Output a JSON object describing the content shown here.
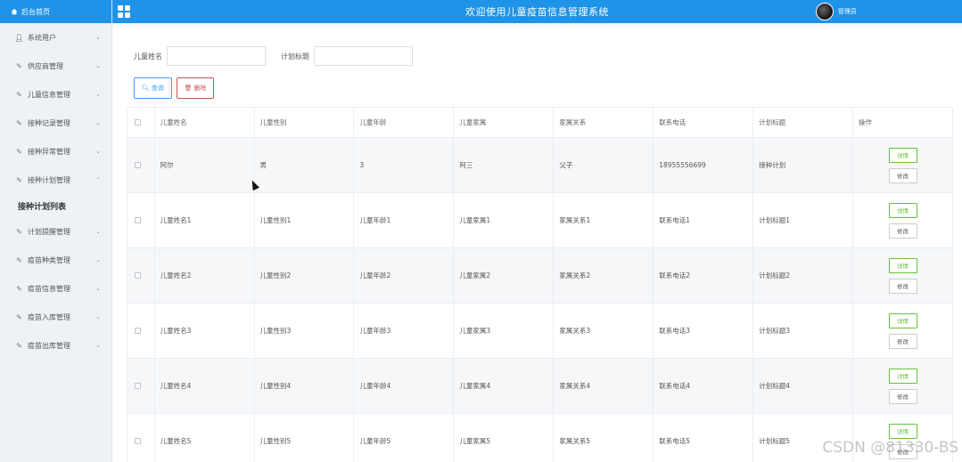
{
  "sidebar": {
    "home_label": "后台首页",
    "items": [
      {
        "label": "系统用户",
        "icon": "user-icon"
      },
      {
        "label": "供应商管理",
        "icon": "edit-icon"
      },
      {
        "label": "儿童信息管理",
        "icon": "edit-icon"
      },
      {
        "label": "接种记录管理",
        "icon": "edit-icon"
      },
      {
        "label": "接种异常管理",
        "icon": "edit-icon"
      },
      {
        "label": "接种计划管理",
        "icon": "edit-icon",
        "expanded": true
      },
      {
        "label": "计划提醒管理",
        "icon": "edit-icon"
      },
      {
        "label": "疫苗种类管理",
        "icon": "edit-icon"
      },
      {
        "label": "疫苗信息管理",
        "icon": "edit-icon"
      },
      {
        "label": "疫苗入库管理",
        "icon": "edit-icon"
      },
      {
        "label": "疫苗出库管理",
        "icon": "edit-icon"
      }
    ],
    "submenu_active": "接种计划列表"
  },
  "header": {
    "title": "欢迎使用儿童疫苗信息管理系统",
    "user_name": "管理员"
  },
  "search": {
    "child_name_label": "儿童姓名",
    "child_name_value": "",
    "plan_title_label": "计划标题",
    "plan_title_value": "",
    "query_label": "查询",
    "delete_label": "删除"
  },
  "table": {
    "columns": [
      "儿童姓名",
      "儿童性别",
      "儿童年龄",
      "儿童家属",
      "家属关系",
      "联系电话",
      "计划标题",
      "操作"
    ],
    "rows": [
      [
        "阿尔",
        "男",
        "3",
        "阿三",
        "父子",
        "18955556699",
        "接种计划"
      ],
      [
        "儿童姓名1",
        "儿童性别1",
        "儿童年龄1",
        "儿童家属1",
        "家属关系1",
        "联系电话1",
        "计划标题1"
      ],
      [
        "儿童姓名2",
        "儿童性别2",
        "儿童年龄2",
        "儿童家属2",
        "家属关系2",
        "联系电话2",
        "计划标题2"
      ],
      [
        "儿童姓名3",
        "儿童性别3",
        "儿童年龄3",
        "儿童家属3",
        "家属关系3",
        "联系电话3",
        "计划标题3"
      ],
      [
        "儿童姓名4",
        "儿童性别4",
        "儿童年龄4",
        "儿童家属4",
        "家属关系4",
        "联系电话4",
        "计划标题4"
      ],
      [
        "儿童姓名5",
        "儿童性别5",
        "儿童年龄5",
        "儿童家属5",
        "家属关系5",
        "联系电话5",
        "计划标题5"
      ]
    ],
    "detail_label": "详情",
    "edit_label": "修改"
  },
  "watermark": "CSDN @81330-BS",
  "colors": {
    "header": "#1e93e8",
    "sidebar": "#eef2f5",
    "detail": "#67c23a",
    "delete": "#c45656",
    "query": "#409eff"
  }
}
